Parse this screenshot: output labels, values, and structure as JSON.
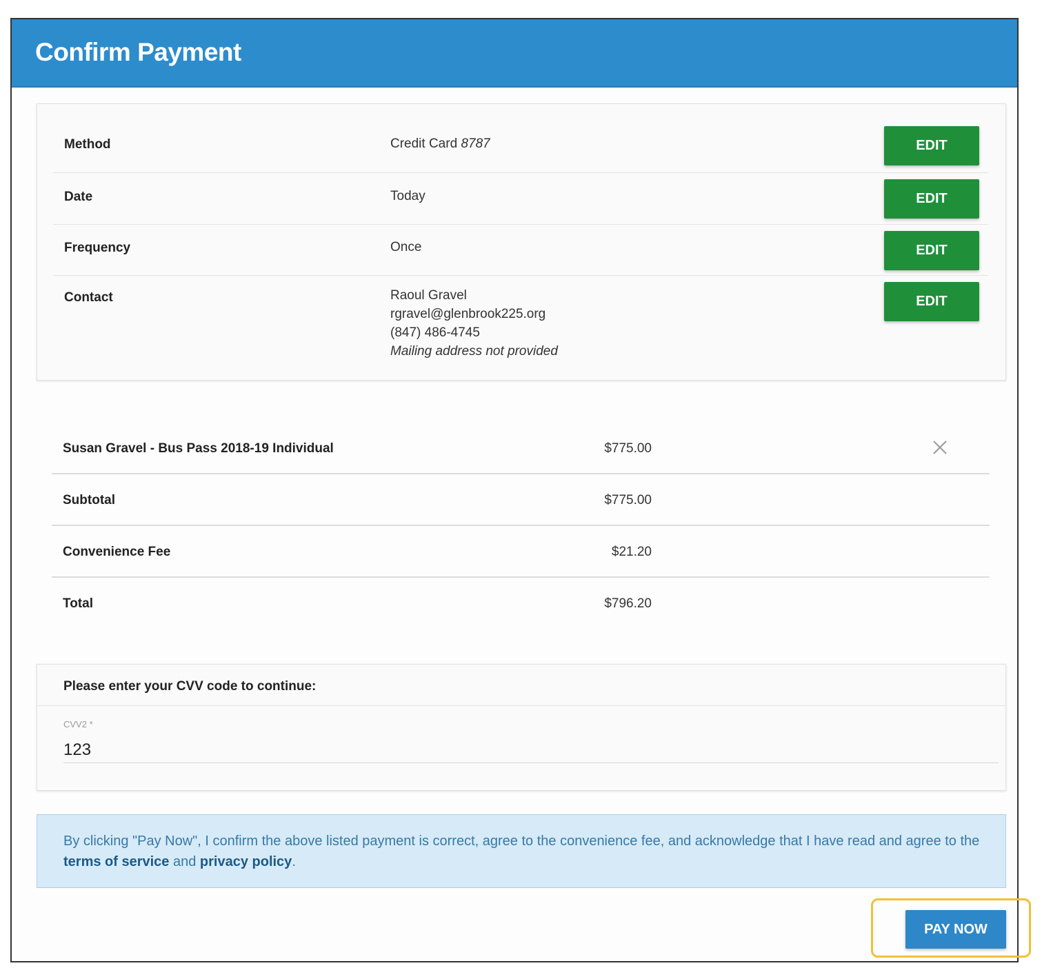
{
  "header": {
    "title": "Confirm Payment"
  },
  "details": {
    "rows": [
      {
        "label": "Method",
        "value": "Credit Card",
        "value_suffix": "8787",
        "edit_label": "EDIT"
      },
      {
        "label": "Date",
        "value": "Today",
        "edit_label": "EDIT"
      },
      {
        "label": "Frequency",
        "value": "Once",
        "edit_label": "EDIT"
      },
      {
        "label": "Contact",
        "name": "Raoul Gravel",
        "email": "rgravel@glenbrook225.org",
        "phone": "(847) 486-4745",
        "address_note": "Mailing address not provided",
        "edit_label": "EDIT"
      }
    ]
  },
  "items": {
    "line_item": {
      "label": "Susan Gravel - Bus Pass 2018-19 Individual",
      "amount": "$775.00"
    },
    "subtotal": {
      "label": "Subtotal",
      "amount": "$775.00"
    },
    "fee": {
      "label": "Convenience Fee",
      "amount": "$21.20"
    },
    "total": {
      "label": "Total",
      "amount": "$796.20"
    }
  },
  "cvv": {
    "title": "Please enter your CVV code to continue:",
    "field_label": "CVV2 *",
    "value": "123"
  },
  "notice": {
    "text_before": "By clicking \"Pay Now\", I confirm the above listed payment is correct, agree to the convenience fee, and acknowledge that I have read and agree to the ",
    "terms_link": "terms of service",
    "text_middle": " and ",
    "privacy_link": "privacy policy",
    "text_after": "."
  },
  "actions": {
    "pay_label": "PAY NOW"
  },
  "colors": {
    "header": "#2d8ccb",
    "edit_button": "#1f8f3a",
    "pay_button": "#2d87c8",
    "notice_bg": "#d7eaf7",
    "highlight": "#f2c037"
  }
}
